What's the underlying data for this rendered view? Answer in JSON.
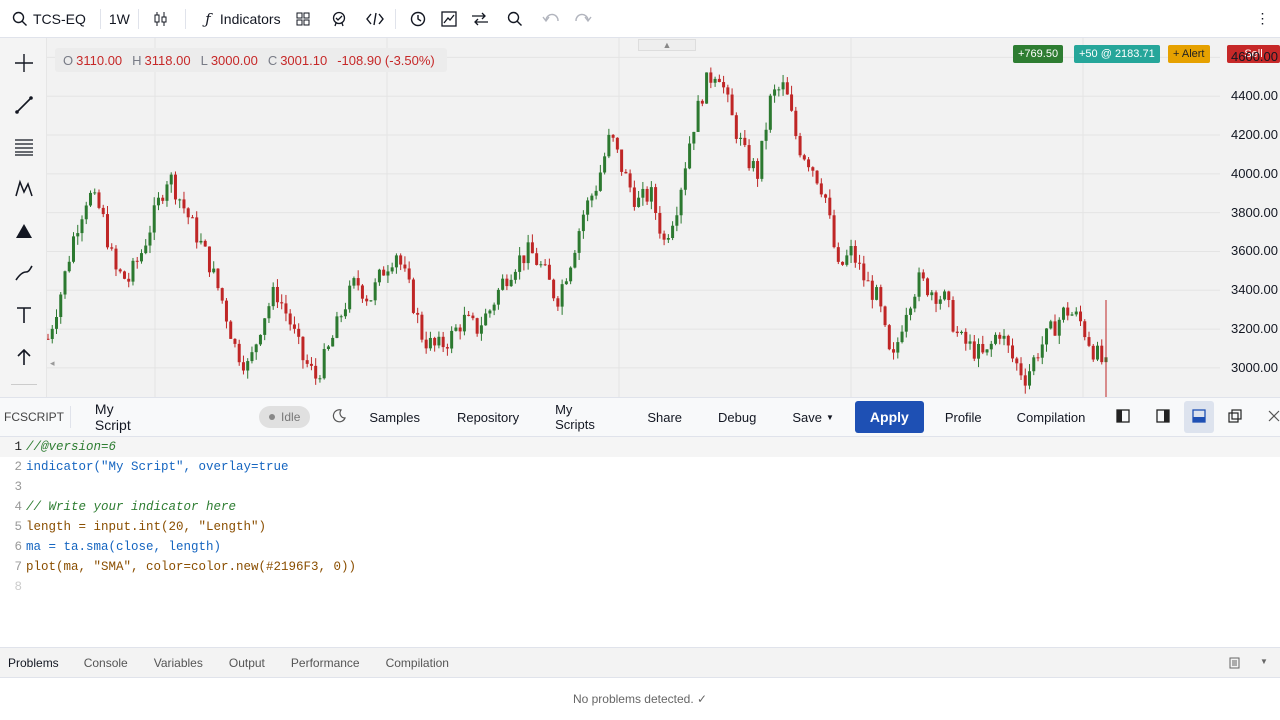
{
  "toolbar": {
    "symbol": "TCS-EQ",
    "interval": "1W",
    "indicators_label": "Indicators"
  },
  "ohlc": {
    "o_label": "O",
    "o_value": "3110.00",
    "h_label": "H",
    "h_value": "3118.00",
    "l_label": "L",
    "l_value": "3000.00",
    "c_label": "C",
    "c_value": "3001.10",
    "change": "-108.90 (-3.50%)"
  },
  "badges": {
    "pnl": "+769.50",
    "position": "+50 @ 2183.71",
    "alert": "+ Alert",
    "sell": "Sell"
  },
  "price_axis": [
    "4600.00",
    "4400.00",
    "4200.00",
    "4000.00",
    "3800.00",
    "3600.00",
    "3400.00",
    "3200.00",
    "3000.00"
  ],
  "editor_header": {
    "brand": "FCSCRIPT",
    "script_name": "My Script",
    "status": "Idle",
    "samples": "Samples",
    "repository": "Repository",
    "my_scripts": "My Scripts",
    "share": "Share",
    "debug": "Debug",
    "save": "Save",
    "apply": "Apply",
    "profile": "Profile",
    "compilation": "Compilation"
  },
  "code_lines": [
    {
      "n": "1",
      "t": "//@version=6"
    },
    {
      "n": "2",
      "t": "indicator(\"My Script\", overlay=true"
    },
    {
      "n": "3",
      "t": ""
    },
    {
      "n": "4",
      "t": "// Write your indicator here"
    },
    {
      "n": "5",
      "t": "length = input.int(20, \"Length\")"
    },
    {
      "n": "6",
      "t": "ma = ta.sma(close, length)"
    },
    {
      "n": "7",
      "t": "plot(ma, \"SMA\", color=color.new(#2196F3, 0))"
    },
    {
      "n": "8",
      "t": ""
    }
  ],
  "bottom_tabs": [
    "Problems",
    "Console",
    "Variables",
    "Output",
    "Performance",
    "Compilation"
  ],
  "problems_message": "No problems detected. ✓",
  "colors": {
    "up": "#2e7d32",
    "down": "#c62828",
    "apply": "#1e50b4",
    "pnl_badge": "#2e7d32",
    "position_badge": "#26a69a",
    "alert_badge": "#e6a100",
    "sell_badge": "#c62828"
  },
  "chart_data": {
    "type": "candlestick",
    "ylim": [
      2850,
      4700
    ],
    "close_path": [
      3150,
      3400,
      3700,
      3900,
      3800,
      3500,
      3450,
      3600,
      3800,
      4000,
      3850,
      3700,
      3550,
      3350,
      3100,
      3000,
      3250,
      3400,
      3250,
      3050,
      2950,
      3100,
      3300,
      3450,
      3350,
      3500,
      3600,
      3400,
      3150,
      3100,
      3150,
      3250,
      3200,
      3300,
      3450,
      3550,
      3600,
      3500,
      3350,
      3550,
      3800,
      3950,
      4200,
      4000,
      3850,
      3900,
      3650,
      3850,
      4200,
      4450,
      4550,
      4300,
      4100,
      4000,
      4400,
      4450,
      4150,
      4050,
      3900,
      3500,
      3600,
      3450,
      3350,
      3000,
      3300,
      3450,
      3400,
      3350,
      3150,
      3100,
      3050,
      3200,
      3050,
      2950,
      3100,
      3200,
      3300,
      3250,
      3100,
      3001
    ]
  }
}
